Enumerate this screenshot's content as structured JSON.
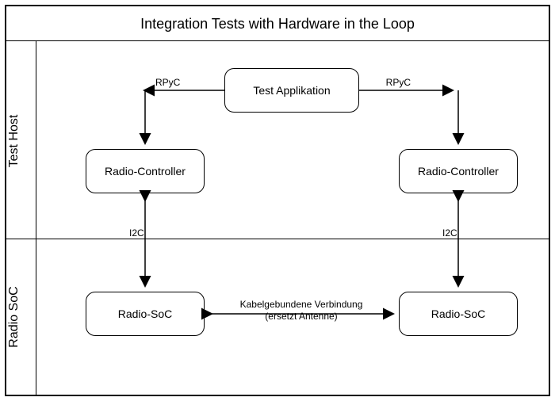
{
  "title": "Integration Tests with Hardware in the Loop",
  "lanes": {
    "top": "Test Host",
    "bottom": "Radio SoC"
  },
  "nodes": {
    "testapp": "Test Applikation",
    "rc1": "Radio-Controller",
    "rc2": "Radio-Controller",
    "soc1": "Radio-SoC",
    "soc2": "Radio-SoC"
  },
  "labels": {
    "rpyc1": "RPyC",
    "rpyc2": "RPyC",
    "i2c1": "I2C",
    "i2c2": "I2C",
    "cable1": "Kabelgebundene Verbindung",
    "cable2": "(ersetzt Antenne)"
  }
}
